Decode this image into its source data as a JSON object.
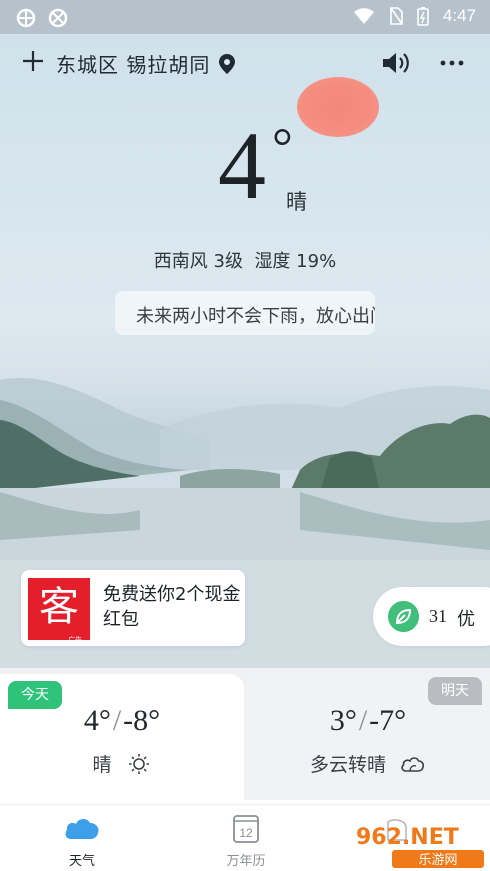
{
  "status_bar": {
    "time": "4:47"
  },
  "header": {
    "add_label": "+",
    "location": "东城区 锡拉胡同"
  },
  "current": {
    "temperature": "4",
    "degree_symbol": "°",
    "condition": "晴",
    "wind_label": "西南风",
    "wind_level": "3级",
    "humidity_label": "湿度",
    "humidity_value": "19%",
    "rain_forecast": "未来两小时不会下雨，放心出门吧"
  },
  "ad": {
    "logo_char": "客",
    "logo_tag": "广告",
    "text": "免费送你2个现金红包"
  },
  "aqi": {
    "value": "31",
    "label": "优",
    "color": "#3fbf7a"
  },
  "forecast": {
    "today": {
      "badge": "今天",
      "high": "4°",
      "separator": "/",
      "low": "-8°",
      "condition": "晴",
      "icon": "sun-icon"
    },
    "tomorrow": {
      "badge": "明天",
      "high": "3°",
      "separator": "/",
      "low": "-7°",
      "condition": "多云转晴",
      "icon": "cloud-icon"
    }
  },
  "tabs": [
    {
      "label": "天气",
      "icon": "cloud-icon",
      "active": true,
      "color": "#1e2328",
      "icon_color": "#3d9eea"
    },
    {
      "label": "万年历",
      "icon": "calendar-icon",
      "active": false,
      "color": "#8a8f94",
      "calendar_day": "12"
    }
  ],
  "watermark": {
    "brand": "962.NET",
    "site": "乐游网"
  }
}
